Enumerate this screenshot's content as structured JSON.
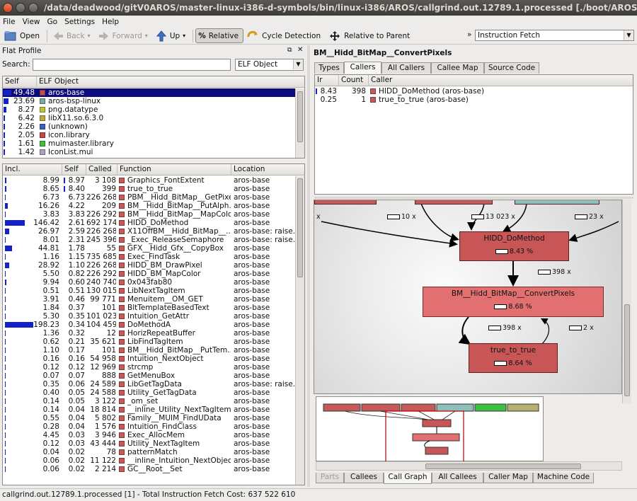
{
  "window": {
    "title": "/data/deadwood/gitV0AROS/master-linux-i386-d-symbols/bin/linux-i386/AROS/callgrind.out.12789.1.processed [./boot/AROSBootstrap]"
  },
  "menu": [
    "File",
    "View",
    "Go",
    "Settings",
    "Help"
  ],
  "toolbar": {
    "open": "Open",
    "back": "Back",
    "forward": "Forward",
    "up": "Up",
    "relative": "Relative",
    "cycle": "Cycle Detection",
    "relparent": "Relative to Parent",
    "more": "»",
    "event": "Instruction Fetch"
  },
  "flat": {
    "title": "Flat Profile",
    "search_label": "Search:",
    "search_value": "",
    "group_select": "ELF Object",
    "objects_headers": [
      "Self",
      "ELF Object"
    ],
    "objects": [
      {
        "self": "49.48",
        "name": "aros-base",
        "color": "#c05050",
        "bar": 0.9
      },
      {
        "self": "23.69",
        "name": "aros-bsp-linux",
        "color": "#7fa8a4",
        "bar": 0.45
      },
      {
        "self": "8.27",
        "name": "png.datatype",
        "color": "#b8c440",
        "bar": 0.15
      },
      {
        "self": "6.42",
        "name": "libX11.so.6.3.0",
        "color": "#c0a840",
        "bar": 0
      },
      {
        "self": "2.26",
        "name": "(unknown)",
        "color": "#4060c0",
        "bar": 0
      },
      {
        "self": "2.05",
        "name": "icon.library",
        "color": "#c04848",
        "bar": 0
      },
      {
        "self": "1.61",
        "name": "muimaster.library",
        "color": "#40c040",
        "bar": 0
      },
      {
        "self": "1.42",
        "name": "IconList.mui",
        "color": "#b0a0c0",
        "bar": 0
      }
    ],
    "func_headers": [
      "Incl.",
      "Self",
      "Called",
      "Function",
      "Location"
    ],
    "functions": [
      {
        "incl": "8.99",
        "self": "8.97",
        "called": "3 108",
        "name": "Graphics_FontExtent",
        "loc": "aros-base",
        "ib": 0.02,
        "sb": 0.02
      },
      {
        "incl": "8.65",
        "self": "8.40",
        "called": "399",
        "name": "true_to_true",
        "loc": "aros-base",
        "ib": 0.02,
        "sb": 0.02
      },
      {
        "incl": "6.73",
        "self": "6.73",
        "called": "226 268",
        "name": "PBM__Hidd_BitMap__GetPixel",
        "loc": "aros-base",
        "ib": 0,
        "sb": 0
      },
      {
        "incl": "16.26",
        "self": "4.22",
        "called": "209",
        "name": "BM__Hidd_BitMap__PutAlph...",
        "loc": "aros-base",
        "ib": 0.05,
        "sb": 0
      },
      {
        "incl": "3.83",
        "self": "3.83",
        "called": "226 292",
        "name": "BM__Hidd_BitMap__MapColor",
        "loc": "aros-base",
        "ib": 0,
        "sb": 0
      },
      {
        "incl": "146.42",
        "self": "2.61",
        "called": "692 174",
        "name": "HIDD_DoMethod",
        "loc": "aros-base",
        "ib": 0.35,
        "sb": 0
      },
      {
        "incl": "26.97",
        "self": "2.59",
        "called": "226 268",
        "name": "X11OffBM__Hidd_BitMap__...",
        "loc": "aros-base: raise.c",
        "ib": 0.07,
        "sb": 0
      },
      {
        "incl": "8.01",
        "self": "2.31",
        "called": "245 396",
        "name": "_Exec_ReleaseSemaphore",
        "loc": "aros-base: raise.c",
        "ib": 0,
        "sb": 0
      },
      {
        "incl": "44.81",
        "self": "1.78",
        "called": "55",
        "name": "GFX__Hidd_Gfx__CopyBox",
        "loc": "aros-base",
        "ib": 0.12,
        "sb": 0
      },
      {
        "incl": "1.16",
        "self": "1.15",
        "called": "735 685",
        "name": "Exec_FindTask",
        "loc": "aros-base",
        "ib": 0,
        "sb": 0
      },
      {
        "incl": "28.92",
        "self": "1.10",
        "called": "226 268",
        "name": "HIDD_BM_DrawPixel",
        "loc": "aros-base",
        "ib": 0.08,
        "sb": 0
      },
      {
        "incl": "5.50",
        "self": "0.82",
        "called": "226 292",
        "name": "HIDD_BM_MapColor",
        "loc": "aros-base",
        "ib": 0,
        "sb": 0
      },
      {
        "incl": "9.94",
        "self": "0.60",
        "called": "240 740",
        "name": "0x043fab80",
        "loc": "aros-base",
        "ib": 0.02,
        "sb": 0
      },
      {
        "incl": "0.51",
        "self": "0.51",
        "called": "130 015",
        "name": "LibNextTagItem",
        "loc": "aros-base",
        "ib": 0,
        "sb": 0
      },
      {
        "incl": "3.91",
        "self": "0.46",
        "called": "99 771",
        "name": "Menuitem__OM_GET",
        "loc": "aros-base",
        "ib": 0,
        "sb": 0
      },
      {
        "incl": "1.84",
        "self": "0.37",
        "called": "101",
        "name": "BltTemplateBasedText",
        "loc": "aros-base",
        "ib": 0,
        "sb": 0
      },
      {
        "incl": "5.30",
        "self": "0.35",
        "called": "101 023",
        "name": "Intuition_GetAttr",
        "loc": "aros-base",
        "ib": 0,
        "sb": 0
      },
      {
        "incl": "198.23",
        "self": "0.34",
        "called": "104 459",
        "name": "DoMethodA",
        "loc": "aros-base",
        "ib": 0.5,
        "sb": 0
      },
      {
        "incl": "1.36",
        "self": "0.32",
        "called": "12",
        "name": "HorizRepeatBuffer",
        "loc": "aros-base",
        "ib": 0,
        "sb": 0
      },
      {
        "incl": "0.62",
        "self": "0.21",
        "called": "35 621",
        "name": "LibFindTagItem",
        "loc": "aros-base",
        "ib": 0,
        "sb": 0
      },
      {
        "incl": "1.10",
        "self": "0.17",
        "called": "101",
        "name": "BM__Hidd_BitMap__PutTem...",
        "loc": "aros-base",
        "ib": 0,
        "sb": 0
      },
      {
        "incl": "0.16",
        "self": "0.16",
        "called": "54 958",
        "name": "Intuition_NextObject",
        "loc": "aros-base",
        "ib": 0,
        "sb": 0
      },
      {
        "incl": "0.12",
        "self": "0.12",
        "called": "12 969",
        "name": "strcmp",
        "loc": "aros-base",
        "ib": 0,
        "sb": 0
      },
      {
        "incl": "0.07",
        "self": "0.07",
        "called": "888",
        "name": "GetMenuBox",
        "loc": "aros-base",
        "ib": 0,
        "sb": 0
      },
      {
        "incl": "0.35",
        "self": "0.06",
        "called": "24 589",
        "name": "LibGetTagData",
        "loc": "aros-base: raise.c",
        "ib": 0,
        "sb": 0
      },
      {
        "incl": "0.40",
        "self": "0.05",
        "called": "24 588",
        "name": "Utility_GetTagData",
        "loc": "aros-base",
        "ib": 0,
        "sb": 0
      },
      {
        "incl": "0.14",
        "self": "0.05",
        "called": "3 122",
        "name": "_om_set",
        "loc": "aros-base",
        "ib": 0,
        "sb": 0
      },
      {
        "incl": "0.14",
        "self": "0.04",
        "called": "18 814",
        "name": "__inline_Utility_NextTagItem",
        "loc": "aros-base",
        "ib": 0,
        "sb": 0
      },
      {
        "incl": "0.55",
        "self": "0.04",
        "called": "5 802",
        "name": "Family__MUIM_FindUData",
        "loc": "aros-base",
        "ib": 0,
        "sb": 0
      },
      {
        "incl": "0.28",
        "self": "0.04",
        "called": "1 576",
        "name": "Intuition_FindClass",
        "loc": "aros-base",
        "ib": 0,
        "sb": 0
      },
      {
        "incl": "4.45",
        "self": "0.03",
        "called": "3 946",
        "name": "Exec_AllocMem",
        "loc": "aros-base",
        "ib": 0,
        "sb": 0
      },
      {
        "incl": "0.12",
        "self": "0.03",
        "called": "43 444",
        "name": "Utility_NextTagItem",
        "loc": "aros-base",
        "ib": 0,
        "sb": 0
      },
      {
        "incl": "0.04",
        "self": "0.02",
        "called": "78",
        "name": "patternMatch",
        "loc": "aros-base",
        "ib": 0,
        "sb": 0
      },
      {
        "incl": "0.06",
        "self": "0.02",
        "called": "11 122",
        "name": "__inline_Intuition_NextObject",
        "loc": "aros-base",
        "ib": 0,
        "sb": 0
      },
      {
        "incl": "0.06",
        "self": "0.02",
        "called": "2 214",
        "name": "GC__Root__Set",
        "loc": "aros-base",
        "ib": 0,
        "sb": 0
      }
    ]
  },
  "detail": {
    "title": "BM__Hidd_BitMap__ConvertPixels",
    "tabs": [
      "Types",
      "Callers",
      "All Callers",
      "Callee Map",
      "Source Code"
    ],
    "callers_headers": [
      "Ir",
      "Count",
      "Caller"
    ],
    "callers": [
      {
        "ir": "8.43",
        "count": "398",
        "name": "HIDD_DoMethod (aros-base)"
      },
      {
        "ir": "0.25",
        "count": "1",
        "name": "true_to_true (aros-base)"
      }
    ],
    "bottom_tabs": [
      "Parts",
      "Callees",
      "Call Graph",
      "All Callees",
      "Caller Map",
      "Machine Code"
    ]
  },
  "graph": {
    "node_main_top": {
      "name": "HIDD_DoMethod",
      "cost": "8.43 %"
    },
    "node_center": {
      "name": "BM__Hidd_BitMap__ConvertPixels",
      "cost": "8.68 %"
    },
    "node_bottom": {
      "name": "true_to_true",
      "cost": "8.64 %"
    },
    "edges": {
      "a": "10 x",
      "b": "13 023 x",
      "c": "23 x",
      "d": "398 x",
      "e": "398 x",
      "f": "2 x",
      "g": "x"
    }
  },
  "status": {
    "text": "callgrind.out.12789.1.processed [1] - Total Instruction Fetch Cost: 637 522 610"
  }
}
